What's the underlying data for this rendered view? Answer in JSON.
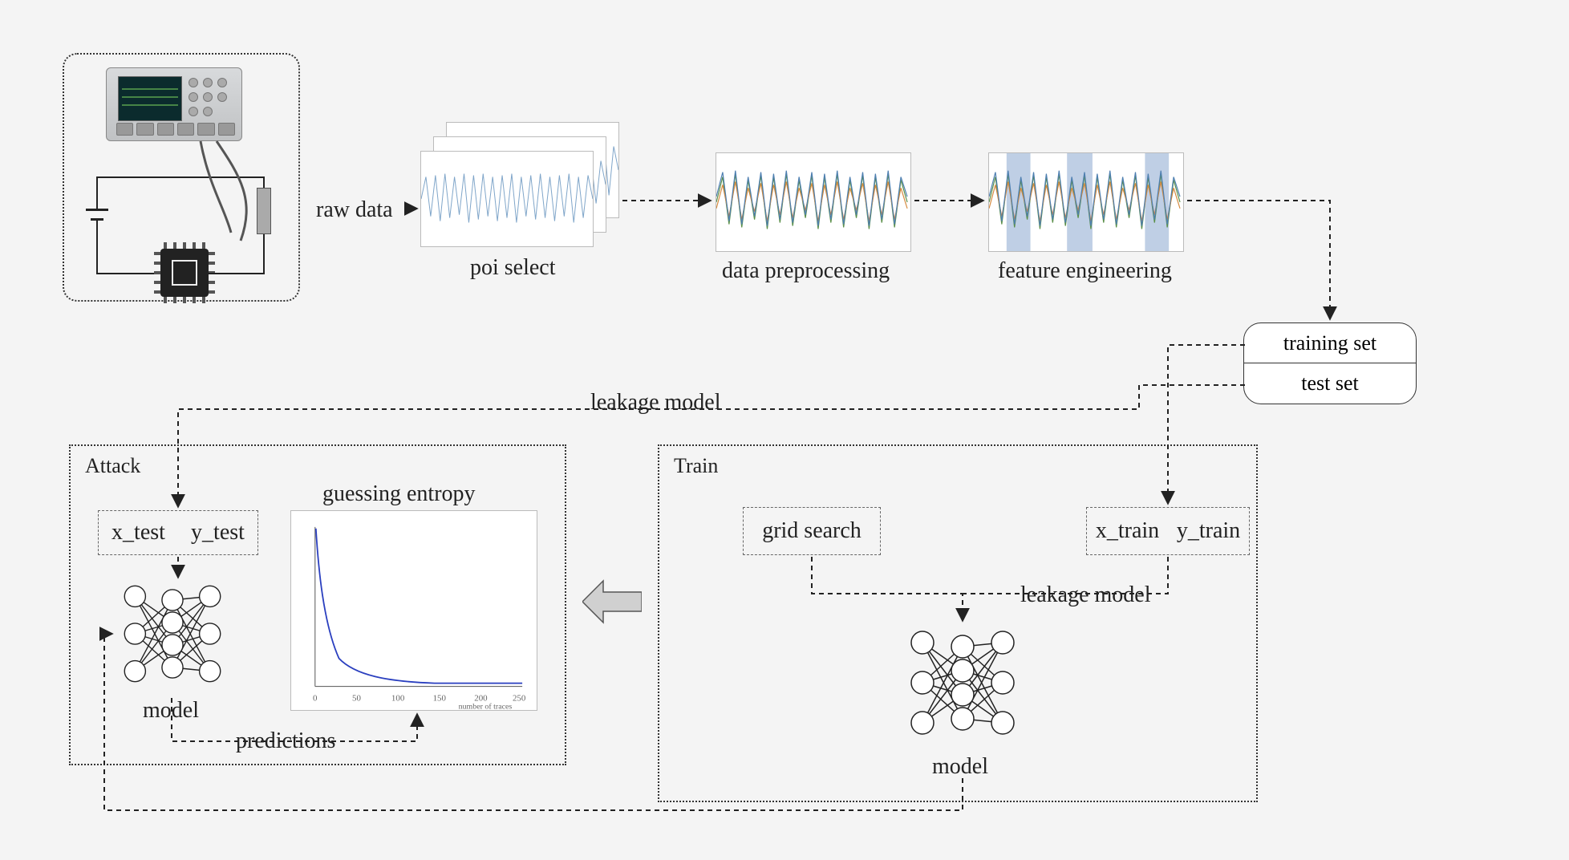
{
  "nodes": {
    "acquisition": {
      "raw_data_label": "raw data",
      "poi_select_label": "poi select",
      "preprocessing_label": "data preprocessing",
      "feature_engineering_label": "feature engineering"
    },
    "dataset_split": {
      "training_label": "training set",
      "test_label": "test set"
    },
    "train": {
      "box_title": "Train",
      "grid_search_label": "grid search",
      "xtrain_label": "x_train",
      "ytrain_label": "y_train",
      "leakage_model_label": "leakage model",
      "model_label": "model"
    },
    "attack": {
      "box_title": "Attack",
      "xtest_label": "x_test",
      "ytest_label": "y_test",
      "model_label": "model",
      "guessing_entropy_label": "guessing entropy",
      "predictions_label": "predictions"
    },
    "pipeline_labels": {
      "leakage_model_edge": "leakage model"
    }
  },
  "chart_data": {
    "type": "line",
    "title": "guessing entropy",
    "xlabel": "number of traces",
    "ylabel": "",
    "x_ticks": [
      0,
      50,
      100,
      150,
      200,
      250
    ],
    "series": [
      {
        "name": "guessing entropy",
        "x": [
          1,
          5,
          10,
          20,
          30,
          50,
          80,
          120,
          180,
          250
        ],
        "values": [
          125,
          70,
          42,
          22,
          14,
          7,
          3,
          2,
          1,
          1
        ]
      }
    ],
    "xlim": [
      0,
      260
    ],
    "ylim": [
      0,
      130
    ]
  }
}
